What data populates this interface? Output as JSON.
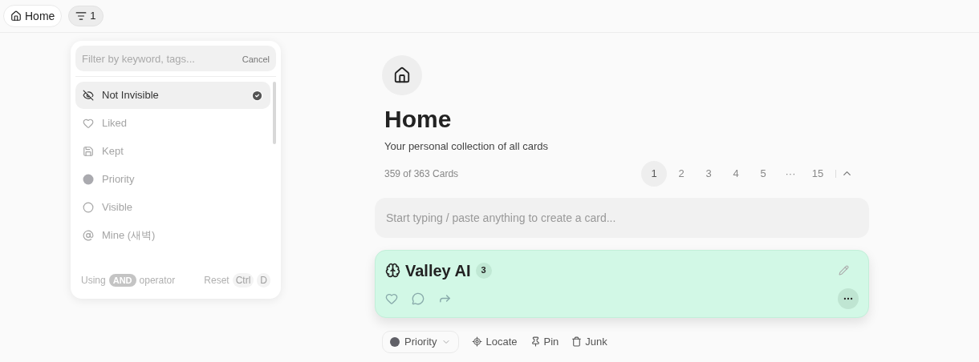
{
  "topbar": {
    "home": "Home",
    "filter_count": "1"
  },
  "filter_menu": {
    "placeholder": "Filter by keyword, tags...",
    "cancel": "Cancel",
    "items": [
      {
        "kind": "invisible",
        "label": "Not Invisible",
        "selected": true
      },
      {
        "kind": "heart",
        "label": "Liked",
        "selected": false
      },
      {
        "kind": "save",
        "label": "Kept",
        "selected": false
      },
      {
        "kind": "dot",
        "label": "Priority",
        "selected": false
      },
      {
        "kind": "circle",
        "label": "Visible",
        "selected": false
      },
      {
        "kind": "at",
        "label": "Mine (새벽)",
        "selected": false
      }
    ],
    "footer": {
      "using": "Using",
      "operator": "AND",
      "operator_suffix": "operator",
      "reset": "Reset",
      "keys": [
        "Ctrl",
        "D"
      ]
    }
  },
  "page": {
    "title": "Home",
    "subtitle": "Your personal collection of all cards",
    "count": "359 of 363 Cards",
    "pages": [
      {
        "label": "1",
        "selected": true
      },
      {
        "label": "2",
        "selected": false
      },
      {
        "label": "3",
        "selected": false
      },
      {
        "label": "4",
        "selected": false
      },
      {
        "label": "5",
        "selected": false
      },
      {
        "label": "···",
        "selected": false
      },
      {
        "label": "15",
        "selected": false
      }
    ],
    "composer_placeholder": "Start typing / paste anything to create a card...",
    "card": {
      "title": "Valley AI",
      "badge": "3"
    },
    "actions": {
      "priority": "Priority",
      "locate": "Locate",
      "pin": "Pin",
      "junk": "Junk"
    }
  }
}
